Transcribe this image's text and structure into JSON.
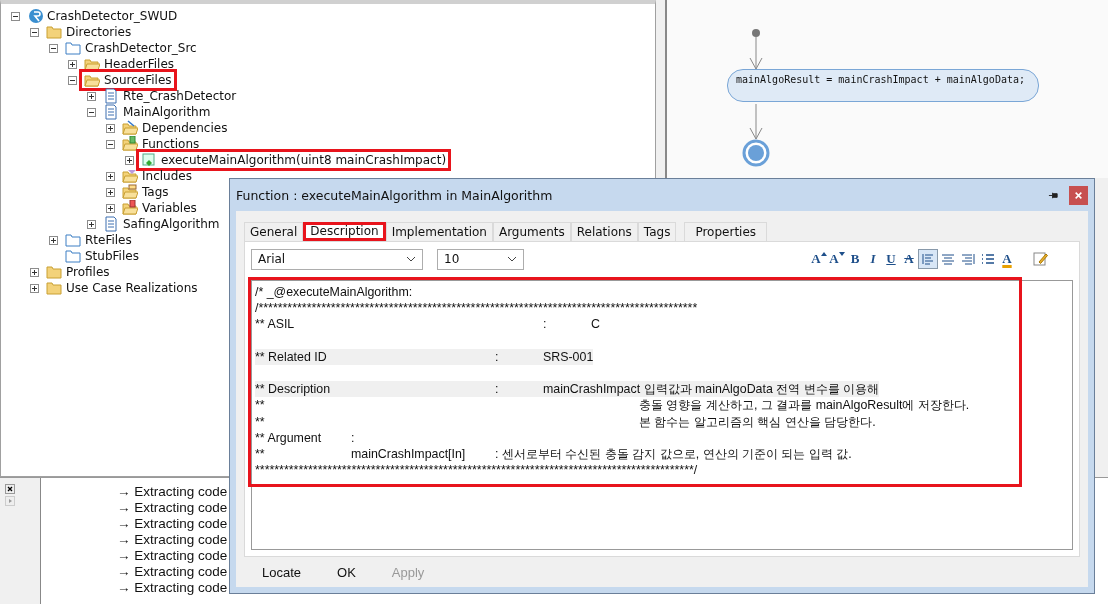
{
  "tree": [
    {
      "label": "CrashDetector_SWUD",
      "kind": "project",
      "expanded": true,
      "highlighted": false,
      "children": [
        {
          "label": "Directories",
          "kind": "folder",
          "expanded": true,
          "highlighted": false,
          "children": [
            {
              "label": "CrashDetector_Src",
              "kind": "dir",
              "expanded": true,
              "highlighted": false,
              "children": [
                {
                  "label": "HeaderFiles",
                  "kind": "open-folder",
                  "expanded": false,
                  "highlighted": false
                },
                {
                  "label": "SourceFiles",
                  "kind": "open-folder",
                  "expanded": true,
                  "highlighted": true,
                  "children": [
                    {
                      "label": "Rte_CrashDetector",
                      "kind": "file",
                      "expanded": false,
                      "highlighted": false
                    },
                    {
                      "label": "MainAlgorithm",
                      "kind": "file",
                      "expanded": true,
                      "highlighted": false,
                      "children": [
                        {
                          "label": "Dependencies",
                          "kind": "dep-folder",
                          "expanded": false,
                          "highlighted": false
                        },
                        {
                          "label": "Functions",
                          "kind": "func-folder",
                          "expanded": true,
                          "highlighted": false,
                          "children": [
                            {
                              "label": "executeMainAlgorithm(uint8 mainCrashImpact)",
                              "kind": "function",
                              "expanded": false,
                              "highlighted": true
                            }
                          ]
                        },
                        {
                          "label": "Includes",
                          "kind": "inc-folder",
                          "expanded": false,
                          "highlighted": false
                        },
                        {
                          "label": "Tags",
                          "kind": "tag-folder",
                          "expanded": false,
                          "highlighted": false
                        },
                        {
                          "label": "Variables",
                          "kind": "var-folder",
                          "expanded": false,
                          "highlighted": false
                        }
                      ]
                    },
                    {
                      "label": "SafingAlgorithm",
                      "kind": "file",
                      "expanded": false,
                      "highlighted": false
                    }
                  ]
                }
              ]
            },
            {
              "label": "RteFiles",
              "kind": "dir",
              "expanded": false,
              "highlighted": false
            },
            {
              "label": "StubFiles",
              "kind": "dir",
              "highlighted": false
            }
          ]
        },
        {
          "label": "Profiles",
          "kind": "folder",
          "expanded": false,
          "highlighted": false
        },
        {
          "label": "Use Case Realizations",
          "kind": "folder",
          "expanded": false,
          "highlighted": false
        }
      ]
    }
  ],
  "diagram": {
    "action": "mainAlgoResult = mainCrashImpact + mainAlgoData;"
  },
  "output": {
    "lines": [
      "→ Extracting code",
      "→ Extracting code",
      "→ Extracting code",
      "→ Extracting code",
      "→ Extracting code",
      "→ Extracting code",
      "→ Extracting code"
    ]
  },
  "dialog": {
    "title": "Function : executeMainAlgorithm in MainAlgorithm",
    "tabs": [
      {
        "label": "General",
        "selected": false,
        "highlighted": false
      },
      {
        "label": "Description",
        "selected": true,
        "highlighted": true
      },
      {
        "label": "Implementation",
        "selected": false,
        "highlighted": false
      },
      {
        "label": "Arguments",
        "selected": false,
        "highlighted": false
      },
      {
        "label": "Relations",
        "selected": false,
        "highlighted": false
      },
      {
        "label": "Tags",
        "selected": false,
        "highlighted": false
      },
      {
        "label": "Properties",
        "selected": false,
        "highlighted": false
      }
    ],
    "font": "Arial",
    "size": "10",
    "format_buttons": [
      {
        "kind": "grow",
        "label": "A"
      },
      {
        "kind": "shrink",
        "label": "A"
      },
      {
        "kind": "bold",
        "label": "B"
      },
      {
        "kind": "italic",
        "label": "I"
      },
      {
        "kind": "underline",
        "label": "U"
      },
      {
        "kind": "strike",
        "label": "A"
      },
      {
        "kind": "align-left",
        "selected": true
      },
      {
        "kind": "align-center",
        "selected": false
      },
      {
        "kind": "align-right",
        "selected": false
      },
      {
        "kind": "bullets"
      },
      {
        "kind": "font-color",
        "label": "A"
      },
      {
        "kind": "edit"
      }
    ],
    "editor_highlighted": true,
    "lines": [
      {
        "text": "/* _@executeMainAlgorithm:",
        "blank_before": false
      },
      {
        "text": "/*******************************************************************************************",
        "blank_before": false
      },
      {
        "text": "** ASIL\t\t\t\t\t\t:\tC",
        "blank_before": false
      },
      {
        "text": "** Related ID\t\t\t\t:\tSRS-001",
        "blank_before": true
      },
      {
        "text": "** Description\t\t\t\t:\tmainCrashImpact 입력값과 mainAlgoData 전역 변수를 이용해",
        "blank_before": true
      },
      {
        "text": "**\t\t\t\t\t\t\t\t충돌 영향을 계산하고, 그 결과를 mainAlgoResult에 저장한다.",
        "blank_before": false
      },
      {
        "text": "**\t\t\t\t\t\t\t\t본 함수는 알고리즘의 핵심 연산을 담당한다.",
        "blank_before": false
      },
      {
        "text": "** Argument\t:",
        "blank_before": false
      },
      {
        "text": "**\t\tmainCrashImpact[In]\t: 센서로부터 수신된 충돌 감지 값으로, 연산의 기준이 되는 입력 값.",
        "blank_before": false
      },
      {
        "text": "*******************************************************************************************/",
        "blank_before": false
      }
    ],
    "buttons": [
      {
        "label": "Locate",
        "disabled": false
      },
      {
        "label": "OK",
        "disabled": false
      },
      {
        "label": "Apply",
        "disabled": true
      }
    ]
  }
}
